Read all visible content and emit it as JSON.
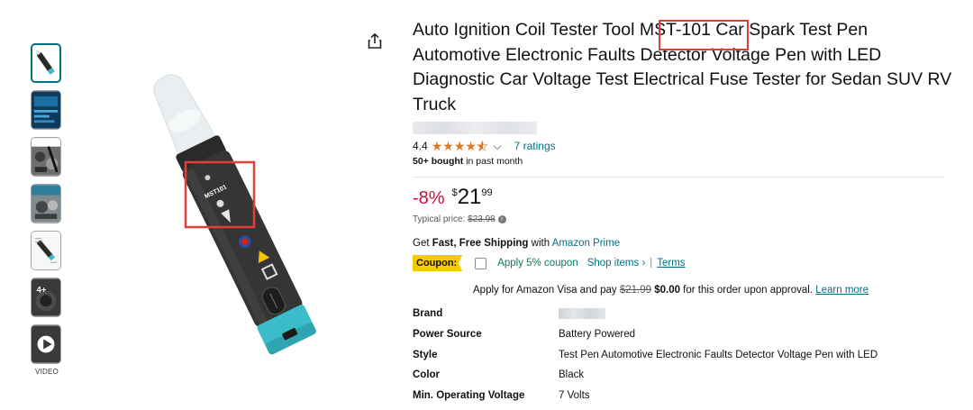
{
  "thumbnails": [
    {
      "name": "thumb-pen",
      "active": true
    },
    {
      "name": "thumb-screen"
    },
    {
      "name": "thumb-engine"
    },
    {
      "name": "thumb-engine-2"
    },
    {
      "name": "thumb-diagram"
    },
    {
      "name": "thumb-4plus"
    },
    {
      "name": "thumb-video"
    }
  ],
  "video_label": "VIDEO",
  "image_label": "MST101",
  "product": {
    "title": "Auto Ignition Coil Tester Tool MST-101 Car Spark Test Pen Automotive Electronic Faults Detector Voltage Pen with LED Diagnostic Car Voltage Test Electrical Fuse Tester for Sedan SUV RV Truck",
    "rating": "4.4",
    "stars_value": 4.4,
    "ratings_count": "7 ratings",
    "bought_bold": "50+ bought",
    "bought_rest": " in past month"
  },
  "price": {
    "discount": "-8%",
    "currency": "$",
    "whole": "21",
    "fraction": "99",
    "typical_label": "Typical price: ",
    "typical_value": "$23.98",
    "info": "i"
  },
  "shipping": {
    "prefix": "Get ",
    "bold": "Fast, Free Shipping",
    "mid": " with ",
    "link": "Amazon Prime"
  },
  "coupon": {
    "badge": "Coupon:",
    "text": "Apply 5% coupon",
    "shop": "Shop items ›",
    "sep": "|",
    "terms": "Terms"
  },
  "visa": {
    "prefix": "Apply for Amazon Visa and pay ",
    "old": "$21.99",
    "new": "$0.00",
    "suffix": " for this order upon approval. ",
    "link": "Learn more"
  },
  "specs": [
    {
      "key": "Brand",
      "value": ""
    },
    {
      "key": "Power Source",
      "value": "Battery Powered"
    },
    {
      "key": "Style",
      "value": "Test Pen Automotive Electronic Faults Detector Voltage Pen with LED"
    },
    {
      "key": "Color",
      "value": "Black"
    },
    {
      "key": "Min. Operating Voltage",
      "value": "7 Volts"
    }
  ],
  "colors": {
    "link": "#007185",
    "discount": "#cc0c39",
    "star": "#de7921",
    "coupon_badge": "#f7ca00",
    "coupon_text": "#067d62",
    "highlight_box": "#e0403a",
    "pen_tip": "#3cbcc8"
  }
}
